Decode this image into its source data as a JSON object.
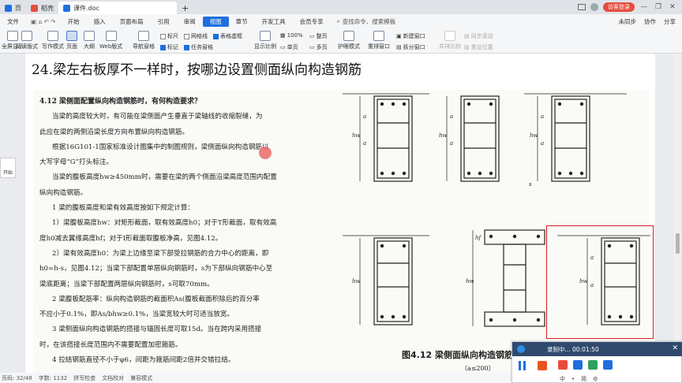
{
  "titlebar": {
    "tabs": [
      {
        "label": "页",
        "color": "#1f6fde"
      },
      {
        "label": "稻壳",
        "color": "#e84c3d"
      },
      {
        "label": "课件.doc",
        "color": "#1f6fde"
      }
    ],
    "new_tab": "+",
    "login": "访客登录",
    "win_minimize": "—",
    "win_maximize": "❐",
    "win_close": "✕"
  },
  "menubar": {
    "items": [
      "文件",
      "开始",
      "插入",
      "页面布局",
      "引用",
      "审阅",
      "视图",
      "章节",
      "开发工具",
      "会员专享"
    ],
    "active": "视图",
    "search_label": "查找命令、搜索模板",
    "right": [
      "未同步",
      "协作",
      "分享"
    ]
  },
  "ribbon": {
    "buttons": [
      {
        "label": "全屏显示",
        "key": "fullscreen"
      },
      {
        "label": "阅读版式",
        "key": "reading"
      },
      {
        "label": "写作模式",
        "key": "writing"
      },
      {
        "label": "页面",
        "key": "page",
        "selected": true
      },
      {
        "label": "大纲",
        "key": "outline"
      },
      {
        "label": "Web版式",
        "key": "web"
      },
      {
        "label": "导航窗格",
        "key": "nav"
      },
      {
        "label": "显示比例",
        "key": "zoom"
      },
      {
        "label": "护眼模式",
        "key": "eye"
      },
      {
        "label": "重排窗口",
        "key": "arrange"
      },
      {
        "label": "新建窗口",
        "key": "newwin"
      },
      {
        "label": "拆分窗口",
        "key": "split"
      },
      {
        "label": "并排比较",
        "key": "compare",
        "dim": true
      },
      {
        "label": "同步滚动",
        "key": "syncscroll",
        "dim": true
      },
      {
        "label": "重设位置",
        "key": "resetpos",
        "dim": true
      }
    ],
    "checks": [
      {
        "label": "标尺",
        "on": false
      },
      {
        "label": "网格线",
        "on": false
      },
      {
        "label": "表格虚框",
        "on": true
      },
      {
        "label": "标记",
        "on": true
      },
      {
        "label": "任务窗格",
        "on": true
      }
    ],
    "zoom_percent": "100%",
    "view_small": [
      "整页",
      "单页",
      "多页"
    ]
  },
  "document": {
    "heading": "24.梁左右板厚不一样时，按哪边设置侧面纵向构造钢筋",
    "book_lines": [
      "4.12  梁侧面配置纵向构造钢筋时，有何构造要求？",
      "当梁的高度较大时，有可能在梁侧面产生垂直于梁轴线的收缩裂缝，为",
      "此应在梁的两侧沿梁长度方向布置纵向构造钢筋。",
      "根据16G101-1国家标准设计图集中的制图规则，梁侧面纵向构造钢筋以",
      "大写字母“G”打头标注。",
      "当梁的腹板高度hw≥450mm时，需要在梁的两个侧面沿梁高度范围内配置",
      "纵向构造钢筋。",
      "1 梁的腹板高度和梁有效高度按如下规定计算：",
      "1）梁腹板高度hw：对矩形截面，取有效高度h0；对于T形截面，取有效高",
      "度h0减去翼缘高度hf；对于I形截面取腹板净高，见图4.12。",
      "2）梁有效高度h0：为梁上边缘至梁下部受拉钢筋的合力中心的距离，即",
      "h0=h-s，见图4.12；当梁下部配置单层纵向钢筋时，s为下部纵向钢筋中心至",
      "梁底距离；当梁下部配置两层纵向钢筋时，s可取70mm。",
      "2 梁腹板配筋率：纵向构造钢筋的截面积As(腹板截面积除后的百分率",
      "不应小于0.1%，即As/bhw≥0.1%，当梁宽较大时可适当放宽。",
      "3 梁侧面纵向构造钢筋的搭接与锚固长度可取15d。当在跨内采用搭接",
      "时，在该搭接长度范围内不需要配置加密箍筋。",
      "4 拉结钢筋直径不小于φ6，间距为箍筋间距2倍并交错拉结。"
    ],
    "figure_caption": "图4.12 梁侧面纵向构造钢筋",
    "figure_sub": "（a≤200）",
    "dim_labels": [
      "hw",
      "a",
      "s",
      "hf"
    ]
  },
  "left_float": {
    "label": "开始"
  },
  "statusbar": {
    "items": [
      "页码: 32/48",
      "字数: 1132",
      "拼写检查",
      "文档校对",
      "兼容模式"
    ]
  },
  "recorder": {
    "title": "录制中... 00:01:50",
    "close": "✕",
    "bottom": [
      "中",
      "•",
      "简",
      "⚙"
    ]
  },
  "colors": {
    "accent": "#1f6fde",
    "danger": "#e84c3d",
    "highlight_box": "#d81e1e",
    "recorder_bar": "#2f4a6d"
  }
}
